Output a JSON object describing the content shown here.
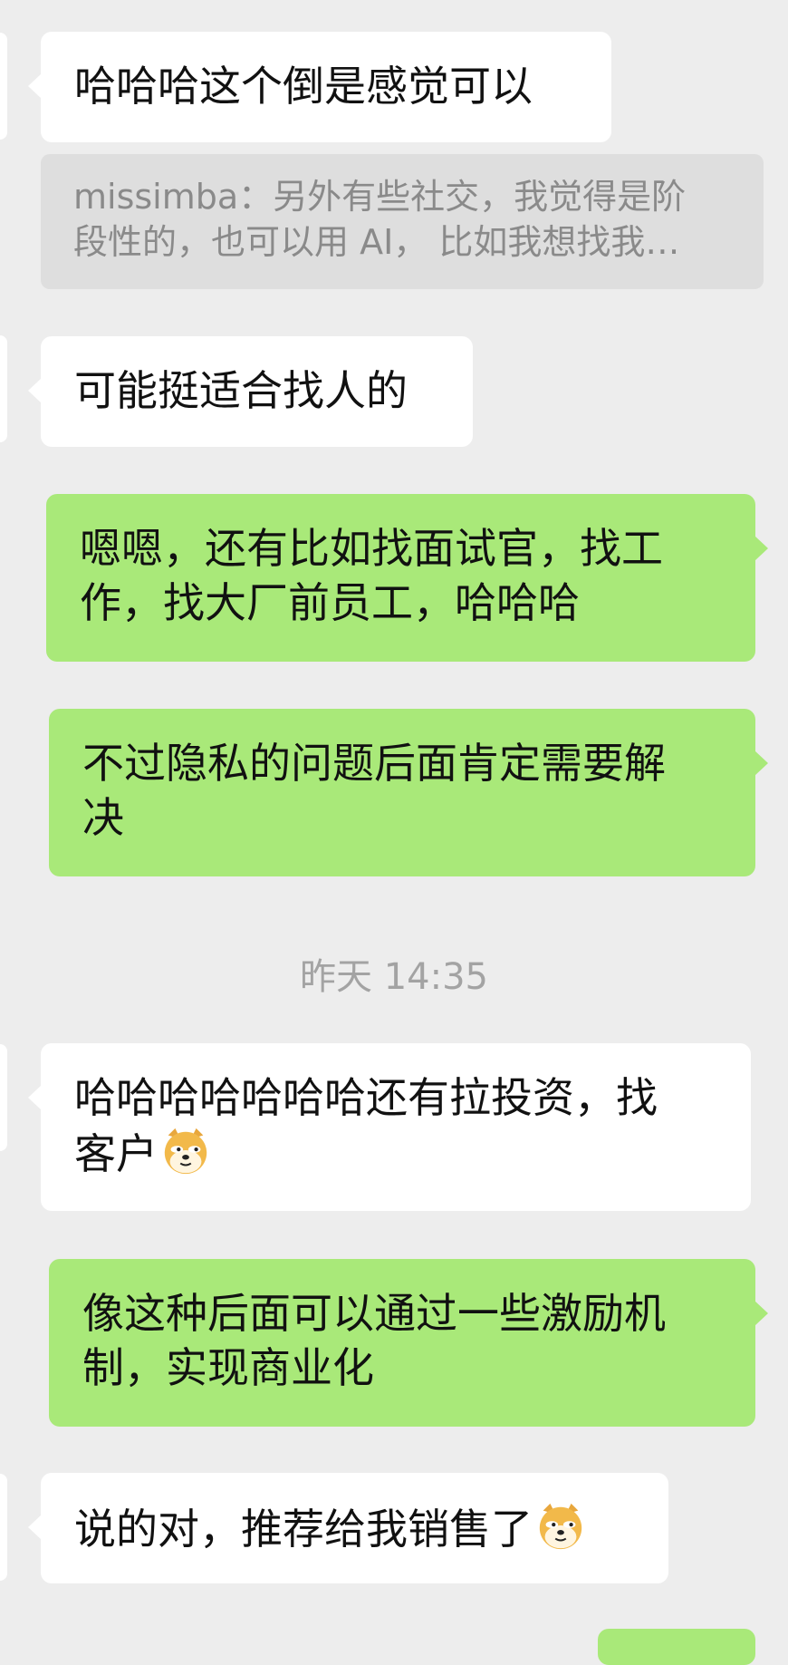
{
  "chat": {
    "messages": [
      {
        "side": "left",
        "text": "哈哈哈这个倒是感觉可以"
      },
      {
        "side": "quote",
        "lines": [
          "missimba：另外有些社交，我觉得是阶",
          "段性的，也可以用 AI，  比如我想找我…"
        ]
      },
      {
        "side": "left",
        "text": "可能挺适合找人的"
      },
      {
        "side": "right",
        "lines": [
          "嗯嗯，还有比如找面试官，找工",
          "作，找大厂前员工，哈哈哈"
        ]
      },
      {
        "side": "right",
        "lines": [
          "不过隐私的问题后面肯定需要解",
          "决"
        ]
      },
      {
        "side": "left",
        "lines": [
          "哈哈哈哈哈哈哈还有拉投资，找",
          "客户"
        ],
        "emoji": "doge-emoji"
      },
      {
        "side": "right",
        "lines": [
          "像这种后面可以通过一些激励机",
          "制，实现商业化"
        ]
      },
      {
        "side": "left",
        "text": "说的对，推荐给我销售了",
        "emoji": "doge-emoji"
      }
    ],
    "timestamp": "昨天 14:35"
  },
  "colors": {
    "background": "#ededed",
    "incoming_bubble": "#ffffff",
    "outgoing_bubble": "#a9e979",
    "quote_bubble": "#dedede",
    "quote_text": "#8a8a8a",
    "timestamp_text": "#a3a3a3"
  }
}
